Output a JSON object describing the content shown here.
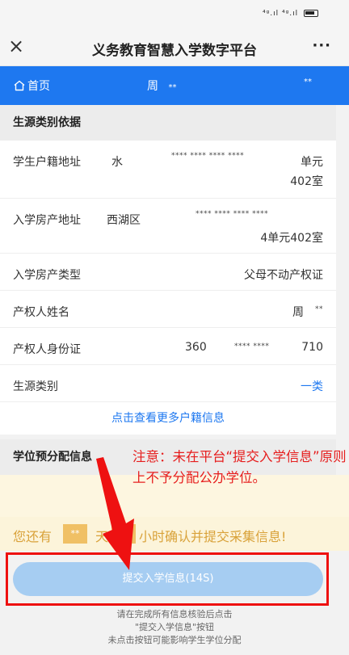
{
  "status_bar": {
    "signal_text": "⁴ᵍ.ıl ⁴ᵍ.ıl"
  },
  "nav": {
    "title": "义务教育智慧入学数字平台",
    "more": "···"
  },
  "blue_bar": {
    "home_label": "首页",
    "name_prefix": "周",
    "name_masked": "**",
    "right_masked": "**"
  },
  "section1": {
    "header": "生源类别依据",
    "rows": [
      {
        "label": "学生户籍地址",
        "v1": "水",
        "masked": "**** **** **** ****",
        "v2": "单元",
        "v3": "402室"
      },
      {
        "label": "入学房产地址",
        "v1": "西湖区",
        "masked": "**** **** **** ****",
        "v2": "4单元402室"
      },
      {
        "label": "入学房产类型",
        "value": "父母不动产权证"
      },
      {
        "label": "产权人姓名",
        "value_main": "周",
        "value_mask": "**"
      },
      {
        "label": "产权人身份证",
        "id_a": "360",
        "id_mask": "**** ****",
        "id_b": "710"
      },
      {
        "label": "生源类别",
        "value": "一类"
      }
    ],
    "link": "点击查看更多户籍信息"
  },
  "section2": {
    "header": "学位预分配信息"
  },
  "countdown": {
    "prefix": "您还有",
    "days_box": "**",
    "mid": "天",
    "suffix": "小时确认并提交采集信息!"
  },
  "submit": {
    "label": "提交入学信息(14S)"
  },
  "hints": [
    "请在完成所有信息核验后点击",
    "\"提交入学信息\"按钮",
    "未点击按钮可能影响学生学位分配"
  ],
  "annotation": {
    "text": "注意：未在平台“提交入学信息”原则上不予分配公办学位。"
  },
  "colors": {
    "accent": "#1e78f0",
    "annotation": "#e61e1e",
    "countdown": "#d9a23a"
  }
}
